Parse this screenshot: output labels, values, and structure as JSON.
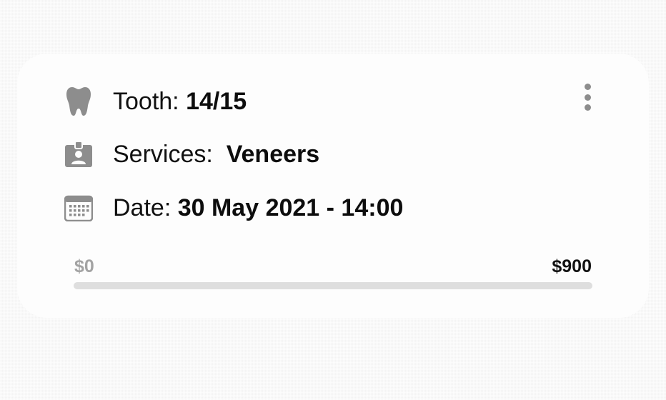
{
  "card": {
    "tooth": {
      "icon": "tooth-icon",
      "label": "Tooth: ",
      "value": "14/15"
    },
    "services": {
      "icon": "id-badge-icon",
      "label": "Services:  ",
      "value": "Veneers"
    },
    "date": {
      "icon": "calendar-icon",
      "label": "Date: ",
      "value": "30 May 2021 - 14:00"
    },
    "menu_icon": "more-vertical-icon",
    "price": {
      "min": "$0",
      "max": "$900",
      "progress_fraction": 0
    }
  },
  "colors": {
    "background": "#f3f3f3",
    "card": "#fdfdfd",
    "icon": "#8d8d8d",
    "track": "#dedede",
    "text_primary": "#111111",
    "text_muted": "#a3a3a3"
  }
}
